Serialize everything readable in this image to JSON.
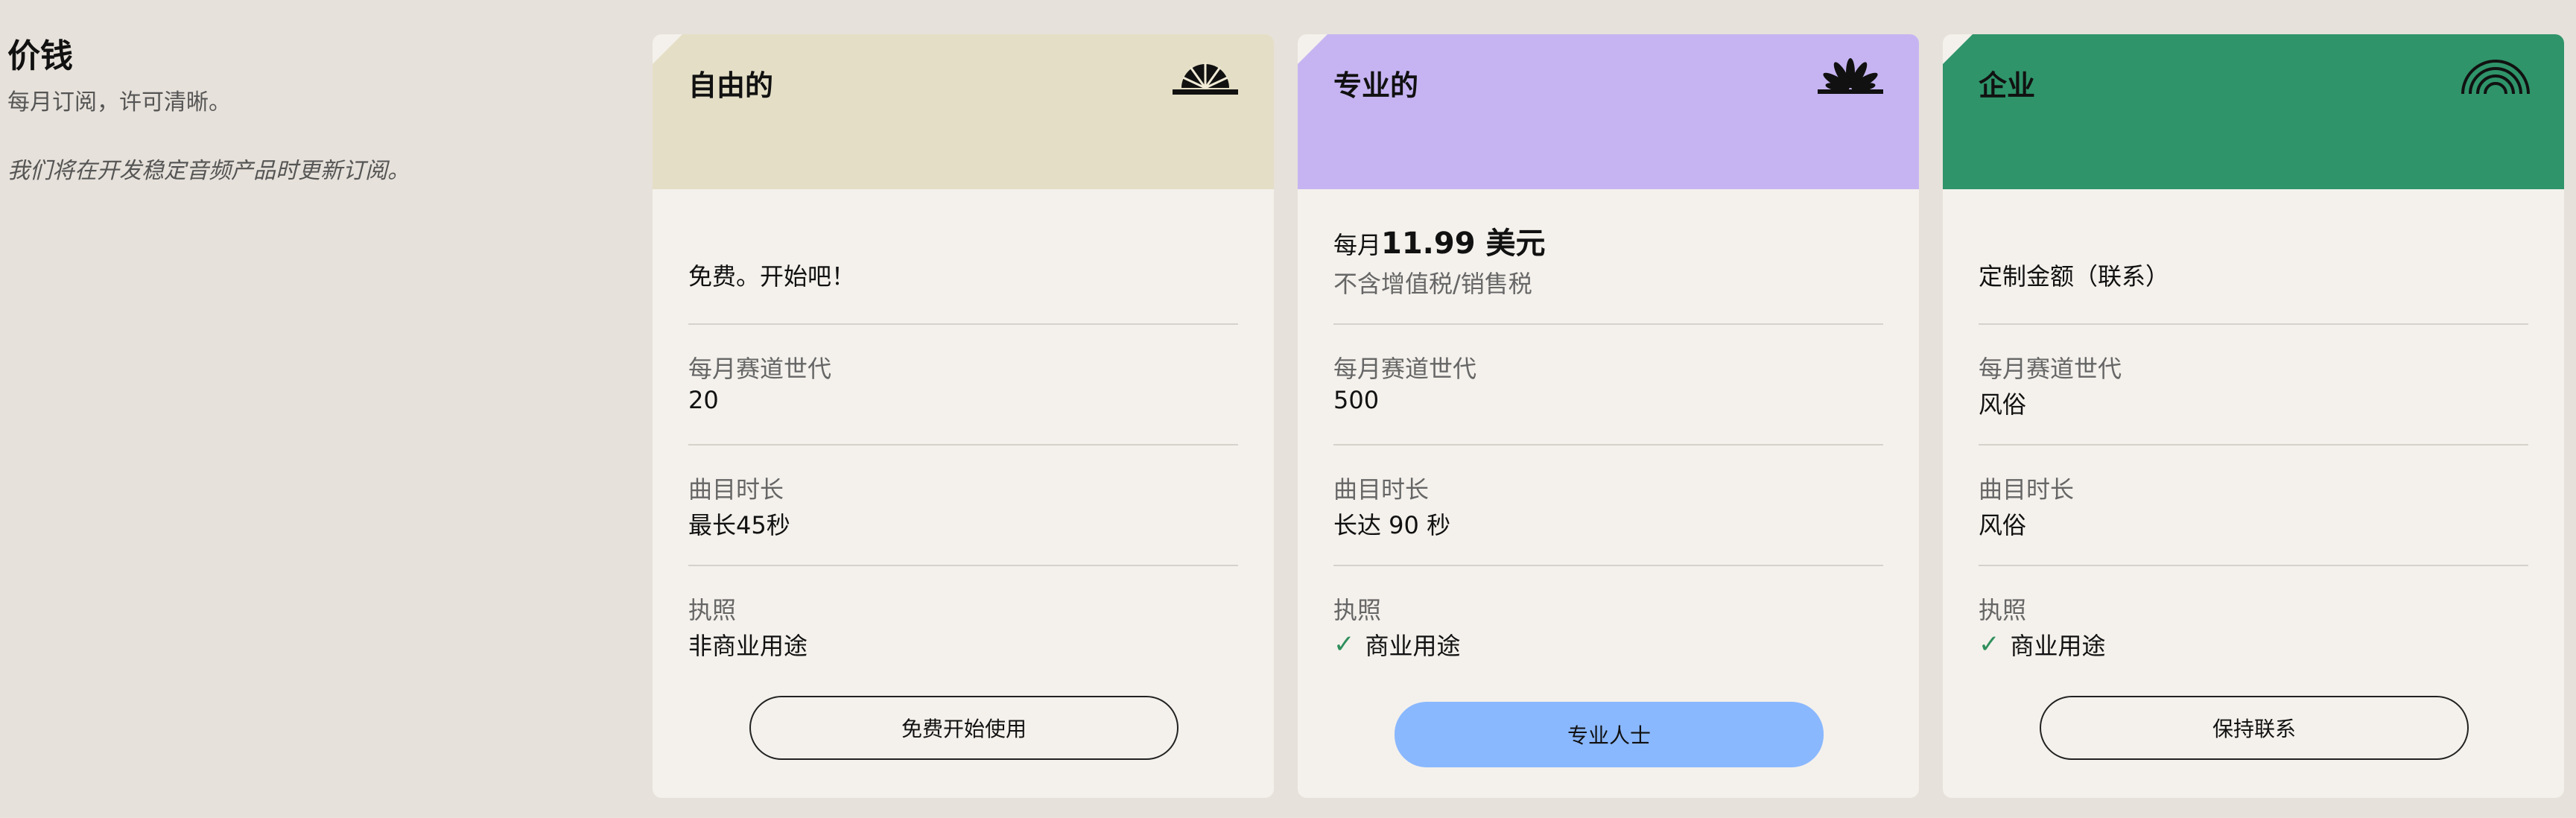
{
  "intro": {
    "title": "价钱",
    "subtitle": "每月订阅，许可清晰。",
    "note": "我们将在开发稳定音频产品时更新订阅。"
  },
  "colors": {
    "free_header": "#e4dec6",
    "pro_header": "#c6b4f2",
    "enterprise_header": "#2f946a",
    "card_bg": "#f4f1ec",
    "page_bg": "#e6e1da",
    "pro_button": "#8ab8ff",
    "check": "#2f8f5c"
  },
  "plans": [
    {
      "name": "自由的",
      "icon": "sunrise-icon",
      "price": "免费。开始吧！",
      "tracks_label": "每月赛道世代",
      "tracks_value": "20",
      "duration_label": "曲目时长",
      "duration_value": "最长45秒",
      "license_label": "执照",
      "license_value": "非商业用途",
      "button": "免费开始使用"
    },
    {
      "name": "专业的",
      "icon": "fan-burst-icon",
      "price_prefix": "每月",
      "price_amount": "11.99 美元",
      "price_note": "不含增值税/销售税",
      "tracks_label": "每月赛道世代",
      "tracks_value": "500",
      "duration_label": "曲目时长",
      "duration_value": "长达 90 秒",
      "license_label": "执照",
      "license_value": "商业用途",
      "button": "专业人士"
    },
    {
      "name": "企业",
      "icon": "rainbow-arc-icon",
      "price": "定制金额（联系）",
      "tracks_label": "每月赛道世代",
      "tracks_value": "风俗",
      "duration_label": "曲目时长",
      "duration_value": "风俗",
      "license_label": "执照",
      "license_value": "商业用途",
      "button": "保持联系"
    }
  ]
}
